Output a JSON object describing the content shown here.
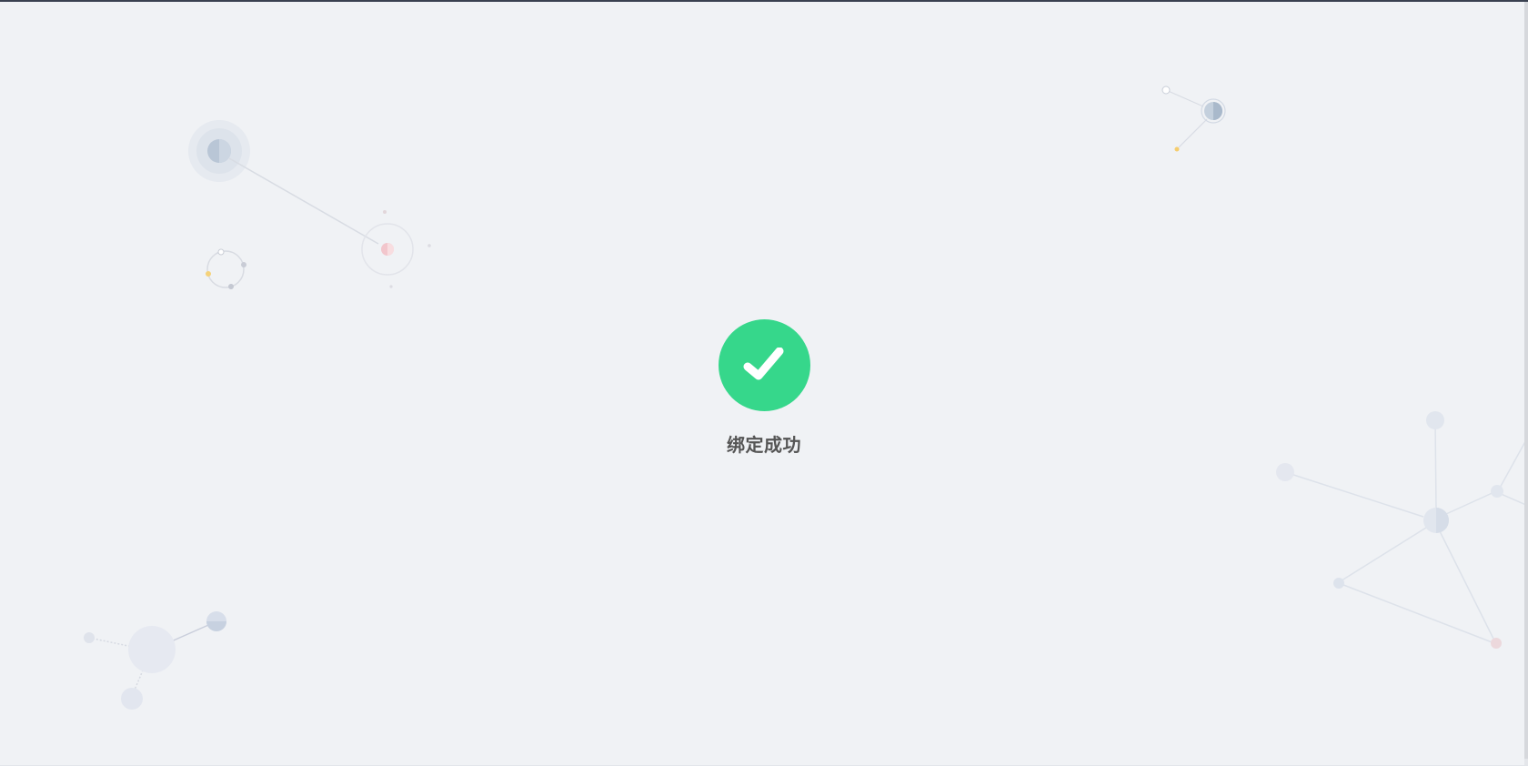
{
  "result": {
    "status_icon": "check-circle-icon",
    "status_color": "#36d78b",
    "title": "绑定成功"
  },
  "theme": {
    "background": "#f0f2f5",
    "text_color": "#555555"
  }
}
